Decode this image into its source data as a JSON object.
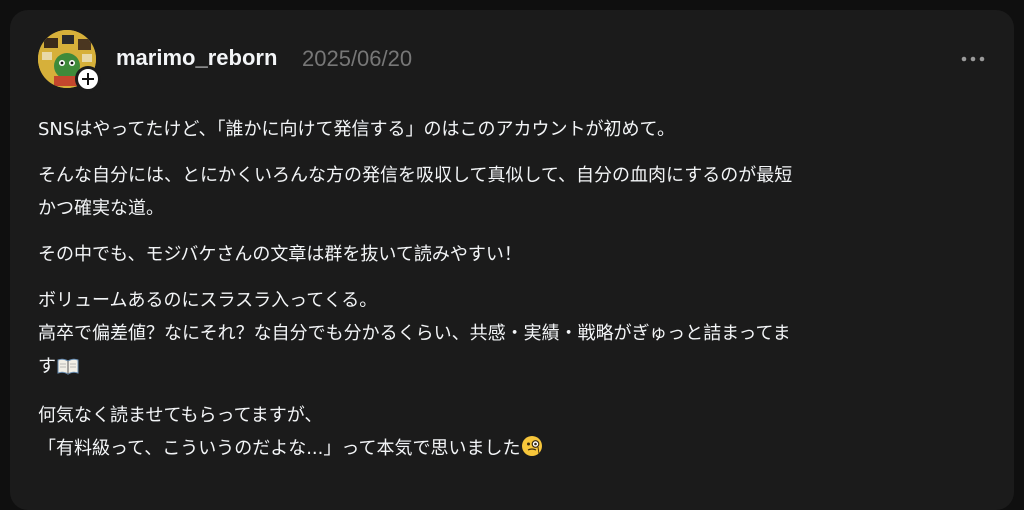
{
  "post": {
    "author": {
      "username": "marimo_reborn",
      "avatar_icon": "avatar-image",
      "follow_icon": "plus-icon"
    },
    "timestamp": "2025/06/20",
    "more_icon": "more-horizontal-icon",
    "paragraphs": [
      {
        "lines": [
          "SNSはやってたけど、「誰かに向けて発信する」のはこのアカウントが初めて。"
        ]
      },
      {
        "lines": [
          "そんな自分には、とにかくいろんな方の発信を吸収して真似して、自分の血肉にするのが最短",
          "かつ確実な道。"
        ]
      },
      {
        "lines": [
          "その中でも、モジバケさんの文章は群を抜いて読みやすい！"
        ]
      },
      {
        "lines": [
          "ボリュームあるのにスラスラ入ってくる。",
          "高卒で偏差値？なにそれ？な自分でも分かるくらい、共感・実績・戦略がぎゅっと詰まってま",
          "す"
        ],
        "trailing_icon": "open-book-icon"
      },
      {
        "lines": [
          "何気なく読ませてもらってますが、",
          "「有料級って、こういうのだよな...」って本気で思いました"
        ],
        "trailing_icon": "monocle-face-icon"
      }
    ]
  },
  "colors": {
    "background": "#0f0f0f",
    "card": "#1b1b1b",
    "text_primary": "#f3f5f7",
    "text_secondary": "#777777"
  }
}
